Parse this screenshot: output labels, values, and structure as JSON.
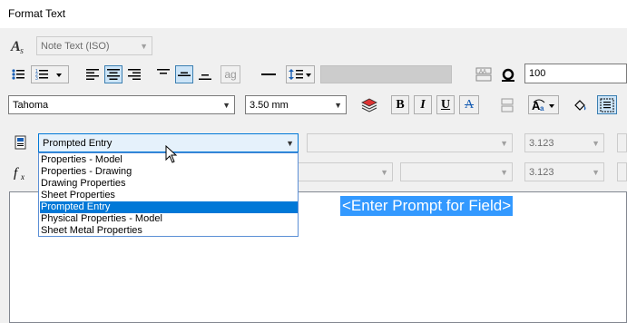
{
  "window": {
    "title": "Format Text"
  },
  "style_combo": {
    "value": "Note Text (ISO)"
  },
  "font_combo": {
    "value": "Tahoma"
  },
  "size_combo": {
    "value": "3.50 mm"
  },
  "width_field": {
    "value": "100"
  },
  "buttons": {
    "bold": "B",
    "italic": "I",
    "underline": "U",
    "strike": "A",
    "ag": "ag"
  },
  "field_type_combo": {
    "value": "Prompted Entry",
    "options": [
      "Properties - Model",
      "Properties - Drawing",
      "Drawing Properties",
      "Sheet Properties",
      "Prompted Entry",
      "Physical Properties - Model",
      "Sheet Metal Properties"
    ],
    "selected_index": 4
  },
  "precision_combos": {
    "row1": "3.123",
    "row2": "3.123"
  },
  "editor": {
    "prompt_text": "<Enter Prompt for Field>"
  },
  "colors": {
    "accent": "#0078d7",
    "highlight": "#3399ff",
    "pressed_bg": "#cce4f7"
  }
}
